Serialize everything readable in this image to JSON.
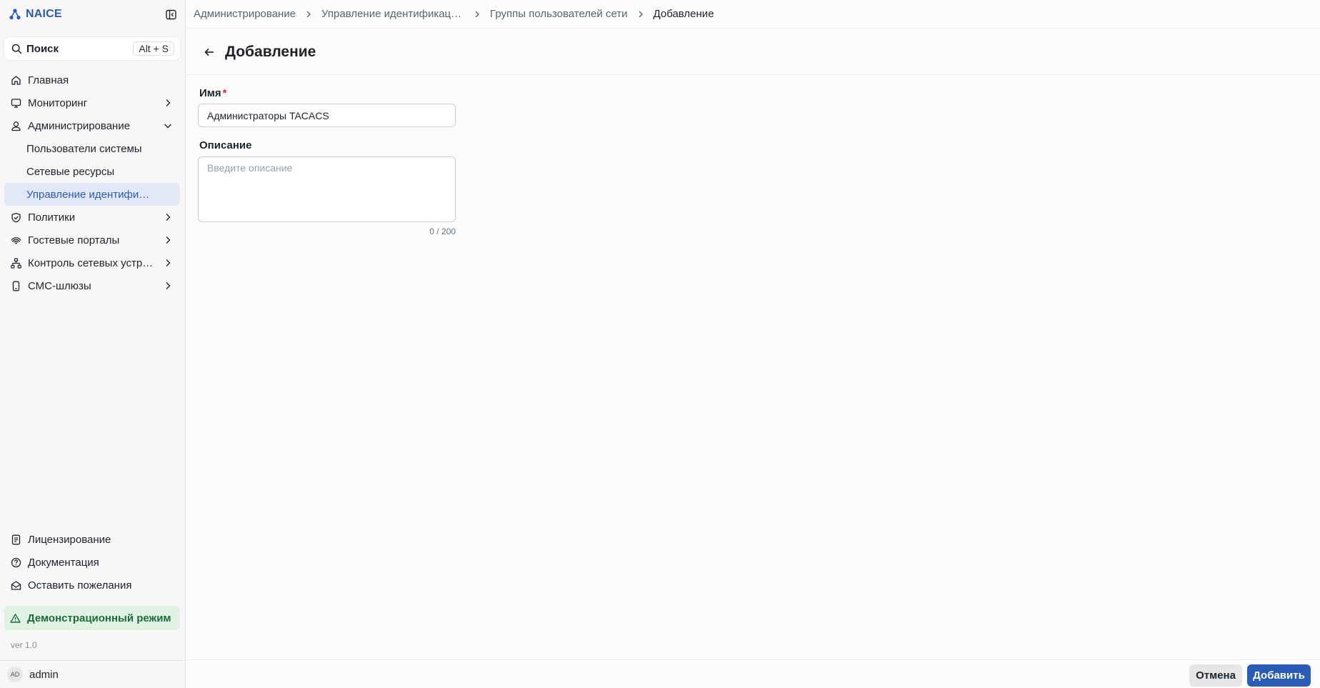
{
  "app": {
    "name": "NAICE"
  },
  "search": {
    "label": "Поиск",
    "shortcut": "Alt + S"
  },
  "sidebar": {
    "items": [
      {
        "label": "Главная",
        "icon": "home-icon"
      },
      {
        "label": "Мониторинг",
        "icon": "monitor-icon"
      },
      {
        "label": "Администрирование",
        "icon": "user-icon"
      },
      {
        "label": "Пользователи системы"
      },
      {
        "label": "Сетевые ресурсы"
      },
      {
        "label": "Управление идентификацией"
      },
      {
        "label": "Политики",
        "icon": "shield-check-icon"
      },
      {
        "label": "Гостевые порталы",
        "icon": "wifi-icon"
      },
      {
        "label": "Контроль сетевых устройств",
        "icon": "network-icon"
      },
      {
        "label": "СМС-шлюзы",
        "icon": "phone-icon"
      }
    ],
    "bottom": [
      {
        "label": "Лицензирование",
        "icon": "license-icon"
      },
      {
        "label": "Документация",
        "icon": "help-icon"
      },
      {
        "label": "Оставить пожелания",
        "icon": "mail-icon"
      }
    ],
    "demo_label": "Демонстрационный режим",
    "version": "ver 1.0",
    "user": {
      "initials": "AD",
      "name": "admin"
    }
  },
  "breadcrumb": {
    "items": [
      "Администрирование",
      "Управление идентификацией",
      "Группы пользователей сети",
      "Добавление"
    ]
  },
  "page": {
    "title": "Добавление"
  },
  "form": {
    "name_label": "Имя",
    "name_required_mark": "*",
    "name_value": "Администраторы TACACS",
    "description_label": "Описание",
    "description_placeholder": "Введите описание",
    "description_counter": "0 / 200"
  },
  "footer": {
    "cancel_label": "Отмена",
    "submit_label": "Добавить"
  },
  "colors": {
    "accent": "#2a5bb5",
    "active_bg": "#e2e8f7",
    "demo_bg": "#dff2e4",
    "demo_text": "#1e6b3a",
    "required": "#c0392b"
  }
}
